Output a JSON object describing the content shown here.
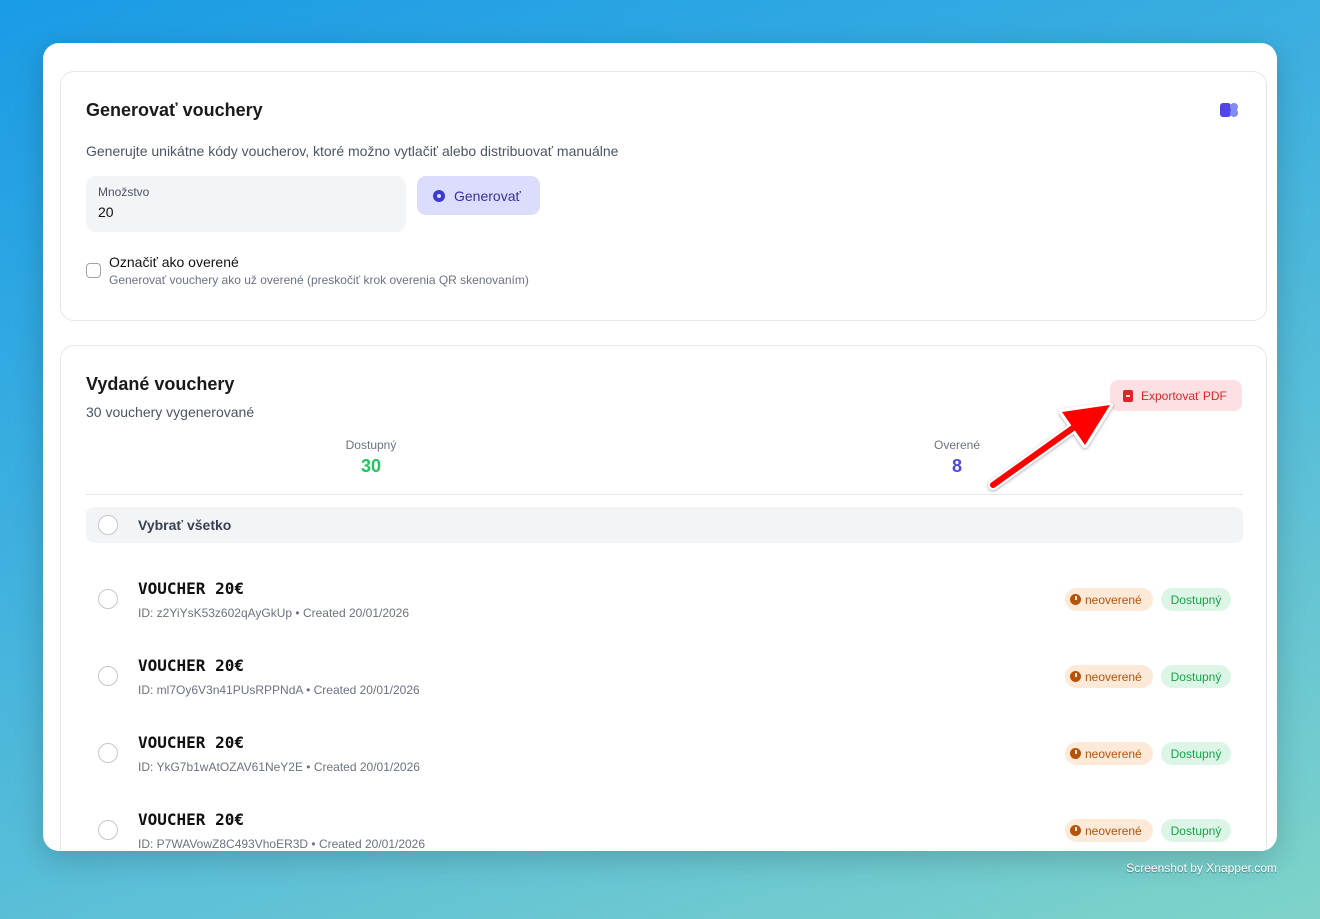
{
  "generate": {
    "title": "Generovať vouchery",
    "description": "Generujte unikátne kódy voucherov, ktoré možno vytlačiť alebo distribuovať manuálne",
    "quantity_label": "Množstvo",
    "quantity_value": "20",
    "button_label": "Generovať",
    "verify_label": "Označiť ako overené",
    "verify_sublabel": "Generovať vouchery ako už overené (preskočiť krok overenia QR skenovaním)"
  },
  "issued": {
    "title": "Vydané vouchery",
    "subtitle": "30 vouchery vygenerované",
    "export_label": "Exportovať PDF",
    "stats": [
      {
        "label": "Dostupný",
        "value": "30",
        "color": "#22c55e"
      },
      {
        "label": "Overené",
        "value": "8",
        "color": "#4f46e5"
      }
    ],
    "select_all_label": "Vybrať všetko",
    "vouchers": [
      {
        "title": "VOUCHER 20€",
        "meta": "ID: z2YiYsK53z602qAyGkUp • Created 20/01/2026",
        "status": "neoverené",
        "availability": "Dostupný"
      },
      {
        "title": "VOUCHER 20€",
        "meta": "ID: ml7Oy6V3n41PUsRPPNdA • Created 20/01/2026",
        "status": "neoverené",
        "availability": "Dostupný"
      },
      {
        "title": "VOUCHER 20€",
        "meta": "ID: YkG7b1wAtOZAV61NeY2E • Created 20/01/2026",
        "status": "neoverené",
        "availability": "Dostupný"
      },
      {
        "title": "VOUCHER 20€",
        "meta": "ID: P7WAVowZ8C493VhoER3D • Created 20/01/2026",
        "status": "neoverené",
        "availability": "Dostupný"
      }
    ]
  },
  "colors": {
    "accent": "#3730a3",
    "export": "#dc2626",
    "unverified": "#b45309",
    "available": "#16a34a",
    "annotation_arrow": "#ff0000"
  },
  "watermark": "Screenshot by Xnapper.com"
}
